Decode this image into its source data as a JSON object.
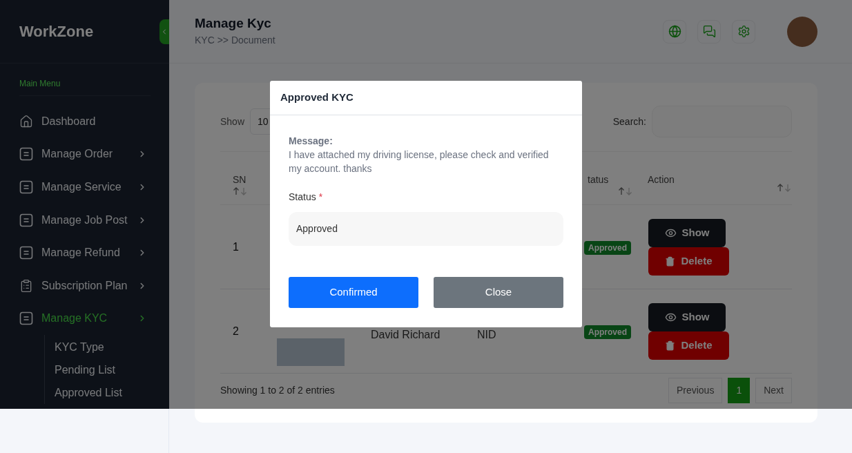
{
  "sidebar": {
    "logo": "WorkZone",
    "section_label": "Main Menu",
    "items": [
      {
        "label": "Dashboard",
        "kind": "home",
        "selected": false,
        "has_submenu": false
      },
      {
        "label": "Manage Order",
        "kind": "list",
        "selected": false,
        "has_submenu": true
      },
      {
        "label": "Manage Service",
        "kind": "list",
        "selected": false,
        "has_submenu": true
      },
      {
        "label": "Manage Job Post",
        "kind": "list",
        "selected": false,
        "has_submenu": true
      },
      {
        "label": "Manage Refund",
        "kind": "list",
        "selected": false,
        "has_submenu": true
      },
      {
        "label": "Subscription Plan",
        "kind": "clipboard",
        "selected": false,
        "has_submenu": true
      },
      {
        "label": "Manage KYC",
        "kind": "list",
        "selected": true,
        "has_submenu": true,
        "children": [
          {
            "label": "KYC Type",
            "selected": false
          },
          {
            "label": "Pending List",
            "selected": false
          },
          {
            "label": "Approved List",
            "selected": false
          }
        ]
      }
    ]
  },
  "header": {
    "title": "Manage Kyc",
    "breadcrumb": "KYC >> Document"
  },
  "table_card": {
    "length_label": "Show",
    "length_value": "10",
    "search_label": "Search:",
    "columns": [
      "SN",
      "tatus",
      "Action"
    ],
    "rows": [
      {
        "sn": "1",
        "status": "Approved",
        "actions": [
          "Show",
          "Delete"
        ]
      },
      {
        "sn": "2",
        "name": "David Richard",
        "type": "NID",
        "status": "Approved",
        "actions": [
          "Show",
          "Delete"
        ]
      }
    ],
    "footer": "Showing 1 to 2 of 2 entries",
    "pagination": [
      {
        "label": "Previous",
        "selected": false
      },
      {
        "label": "1",
        "selected": true
      },
      {
        "label": "Next",
        "selected": false
      }
    ]
  },
  "modal": {
    "title": "Approved KYC",
    "message_label": "Message:",
    "message": "I have attached my driving license, please check and verified my account. thanks",
    "status_label": "Status",
    "required_mark": "*",
    "status_value": "Approved",
    "buttons": [
      {
        "label": "Confirmed",
        "kind": "primary"
      },
      {
        "label": "Close",
        "kind": "secondary"
      }
    ]
  }
}
